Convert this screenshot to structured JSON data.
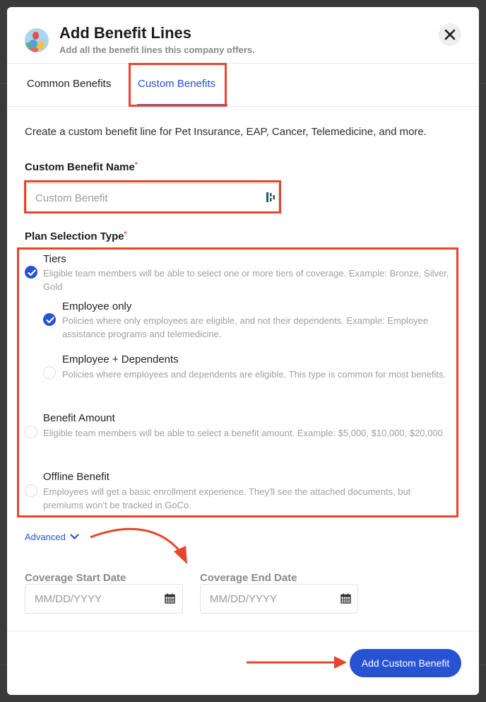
{
  "dialog": {
    "title": "Add Benefit Lines",
    "subtitle": "Add all the benefit lines this company offers.",
    "close_icon": "close-x-icon",
    "avatar_icon": "balloons-illustration"
  },
  "tabs": [
    {
      "label": "Common Benefits",
      "active": false
    },
    {
      "label": "Custom Benefits",
      "active": true
    }
  ],
  "intro_text": "Create a custom benefit line for Pet Insurance, EAP, Cancer, Telemedicine, and more.",
  "custom_benefit_name": {
    "label": "Custom Benefit Name",
    "required_marker": "*",
    "placeholder": "Custom Benefit",
    "value": ""
  },
  "plan_selection": {
    "label": "Plan Selection Type",
    "required_marker": "*",
    "options": [
      {
        "title": "Tiers",
        "description": "Eligible team members will be able to select one or more tiers of coverage. Example: Bronze, Silver, Gold",
        "selected": true
      },
      {
        "title": "Employee only",
        "description": "Policies where only employees are eligible, and not their dependents. Example: Employee assistance programs and telemedicine.",
        "selected": true,
        "sub_option_of": "Tiers"
      },
      {
        "title": "Employee + Dependents",
        "description": "Policies where employees and dependents are eligible. This type is common for most benefits.",
        "selected": false,
        "sub_option_of": "Tiers"
      },
      {
        "title": "Benefit Amount",
        "description": "Eligible team members will be able to select a benefit amount. Example: $5,000, $10,000, $20,000",
        "selected": false
      },
      {
        "title": "Offline Benefit",
        "description": "Employees will get a basic enrollment experience. They'll see the attached documents, but premiums won't be tracked in GoCo.",
        "selected": false
      }
    ]
  },
  "advanced": {
    "label": "Advanced",
    "icon": "chevron-down-icon"
  },
  "coverage_start": {
    "label": "Coverage Start Date",
    "placeholder": "MM/DD/YYYY",
    "icon": "calendar-icon"
  },
  "coverage_end": {
    "label": "Coverage End Date",
    "placeholder": "MM/DD/YYYY",
    "icon": "calendar-icon"
  },
  "footer": {
    "submit_label": "Add Custom Benefit"
  },
  "colors": {
    "accent": "#2752d1",
    "annotation": "#e8452c"
  }
}
